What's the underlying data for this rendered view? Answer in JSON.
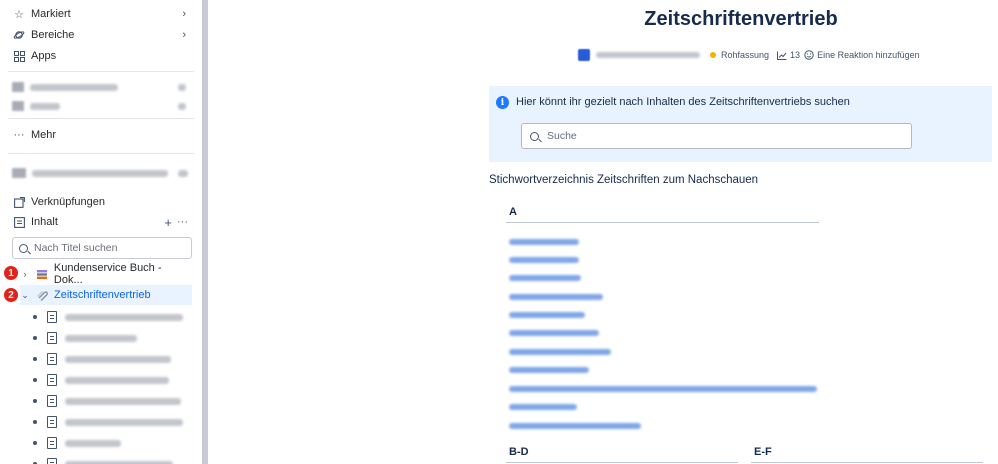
{
  "sidebar": {
    "nav": [
      {
        "label": "Markiert",
        "icon": "star-icon"
      },
      {
        "label": "Bereiche",
        "icon": "planet-icon"
      },
      {
        "label": "Apps",
        "icon": "apps-grid-icon"
      }
    ],
    "more_label": "Mehr",
    "links_label": "Verknüpfungen",
    "content_label": "Inhalt",
    "search_placeholder": "Nach Titel suchen",
    "tree": [
      {
        "label": "Kundenservice Buch - Dok...",
        "badge": "1"
      },
      {
        "label": "Zeitschriftenvertrieb",
        "badge": "2"
      }
    ]
  },
  "page": {
    "title": "Zeitschriftenvertrieb",
    "status": "Rohfassung",
    "views": "13",
    "reaction_label": "Eine Reaktion hinzufügen",
    "info_text": "Hier könnt ihr gezielt nach Inhalten des Zeitschriftenvertriebs suchen",
    "search_placeholder": "Suche",
    "index_heading": "Stichwortverzeichnis Zeitschriften zum Nachschauen",
    "letters": [
      "A",
      "B-D",
      "E-F"
    ]
  },
  "colors": {
    "accent": "#0c66e4",
    "selected_bg": "#e9f2ff",
    "info_panel_bg": "#e9f2ff",
    "status_dot": "#f5b300",
    "badge_red": "#e2231a"
  }
}
